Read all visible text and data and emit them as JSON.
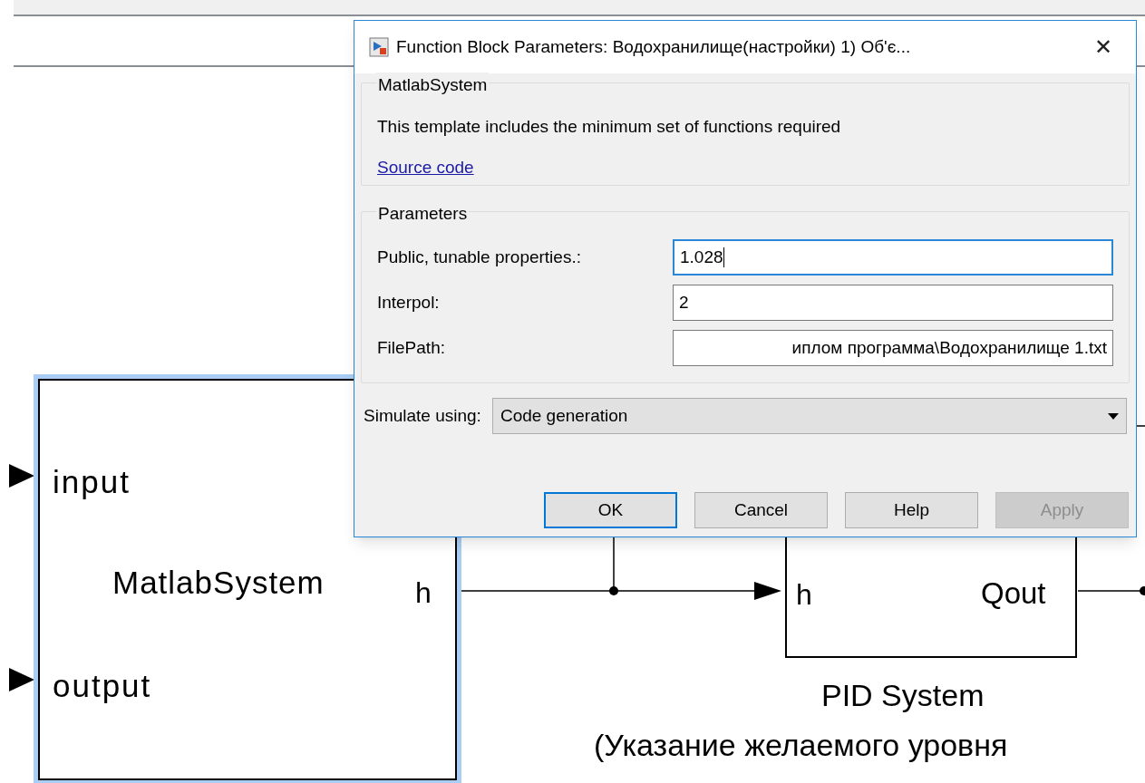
{
  "canvas": {
    "blocks": [
      {
        "name": "MatlabSystem",
        "selected": true,
        "ports_in": [
          "input",
          "output"
        ],
        "ports_out": [
          "h"
        ]
      },
      {
        "selected": false,
        "ports_in": [
          "h"
        ],
        "ports_out": [
          "Qout"
        ],
        "caption": [
          "PID System",
          "(Указание желаемого уровня"
        ]
      }
    ]
  },
  "dialog": {
    "title": "Function Block Parameters: Водохранилище(настройки) 1) Об'є...",
    "close": "✕",
    "description_group": {
      "title": "MatlabSystem",
      "text": "This template includes the minimum set of functions required",
      "link": "Source code"
    },
    "parameters_group": {
      "title": "Parameters",
      "fields": [
        {
          "label": "Public, tunable properties.:",
          "value": "1.028",
          "focused": true
        },
        {
          "label": "Interpol:",
          "value": "2",
          "focused": false
        },
        {
          "label": "FilePath:",
          "value": "иплом программа\\Водохранилище 1.txt",
          "focused": false
        }
      ]
    },
    "simulate": {
      "label": "Simulate using:",
      "value": "Code generation"
    },
    "buttons": [
      {
        "label": "OK",
        "default": true,
        "disabled": false
      },
      {
        "label": "Cancel",
        "default": false,
        "disabled": false
      },
      {
        "label": "Help",
        "default": false,
        "disabled": false
      },
      {
        "label": "Apply",
        "default": false,
        "disabled": true
      }
    ]
  }
}
